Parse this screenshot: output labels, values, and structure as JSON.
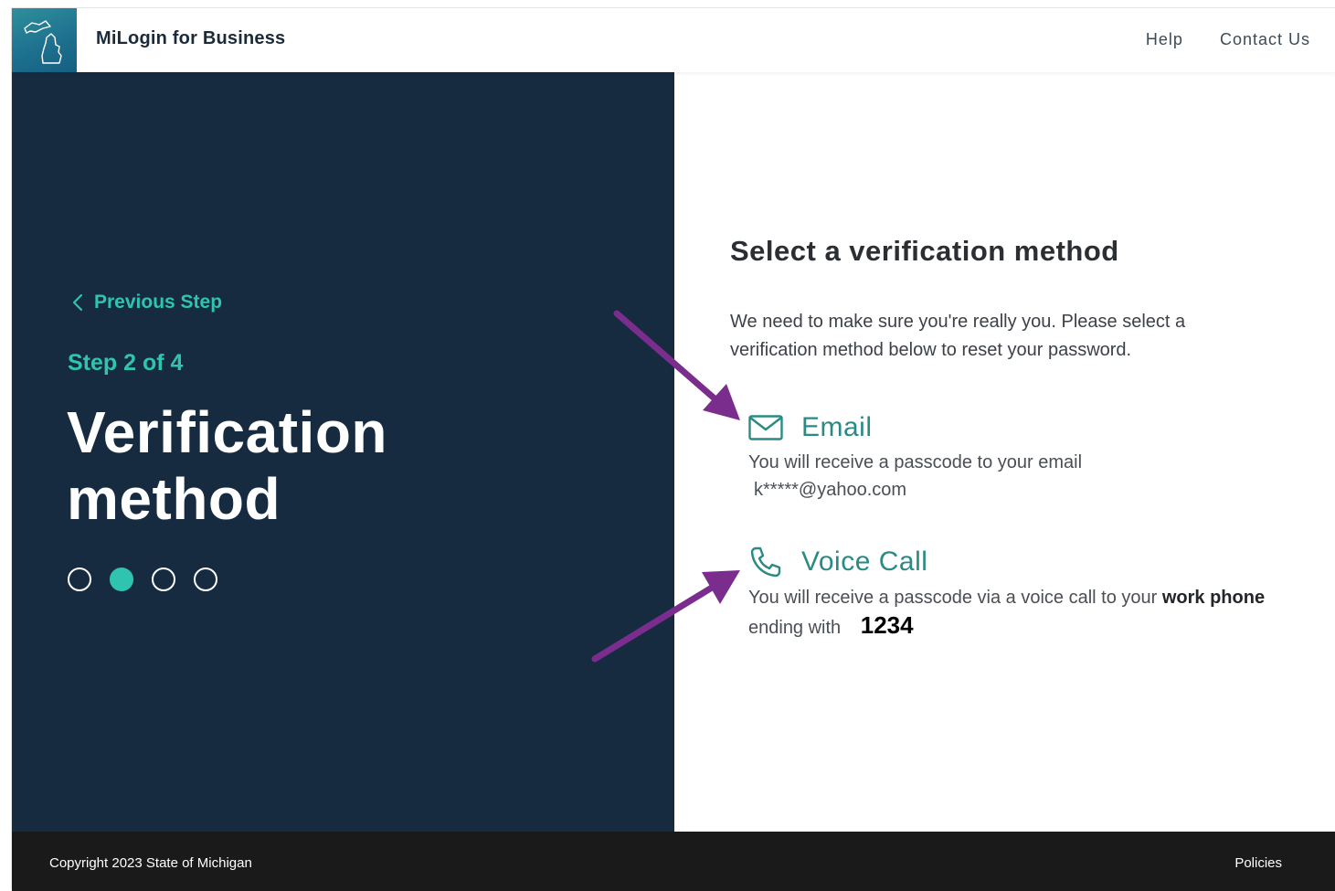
{
  "header": {
    "brand": "MiLogin for Business",
    "nav": {
      "help": "Help",
      "contact": "Contact Us"
    }
  },
  "left_panel": {
    "previous_step": "Previous Step",
    "step_label": "Step 2 of 4",
    "title_line1": "Verification",
    "title_line2": "method",
    "progress": {
      "current": 2,
      "total": 4
    }
  },
  "main": {
    "title": "Select a verification method",
    "intro": "We need to make sure you're really you. Please select a verification method below to reset your password.",
    "methods": {
      "email": {
        "label": "Email",
        "icon": "envelope-icon",
        "desc": "You will receive a passcode to your email",
        "address": "k*****@yahoo.com"
      },
      "voice": {
        "label": "Voice Call",
        "icon": "phone-icon",
        "desc_prefix": "You will receive a passcode via a voice call to your",
        "desc_bold": "work phone",
        "desc_suffix": "ending with",
        "number": "1234"
      }
    }
  },
  "footer": {
    "copyright": "Copyright 2023 State of Michigan",
    "policies": "Policies"
  },
  "colors": {
    "panel_bg": "#162b40",
    "accent_teal": "#2ec4b0",
    "method_teal": "#2a8a84",
    "annotation_arrow": "#7b2d8e",
    "footer_bg": "#1a1a1a"
  }
}
